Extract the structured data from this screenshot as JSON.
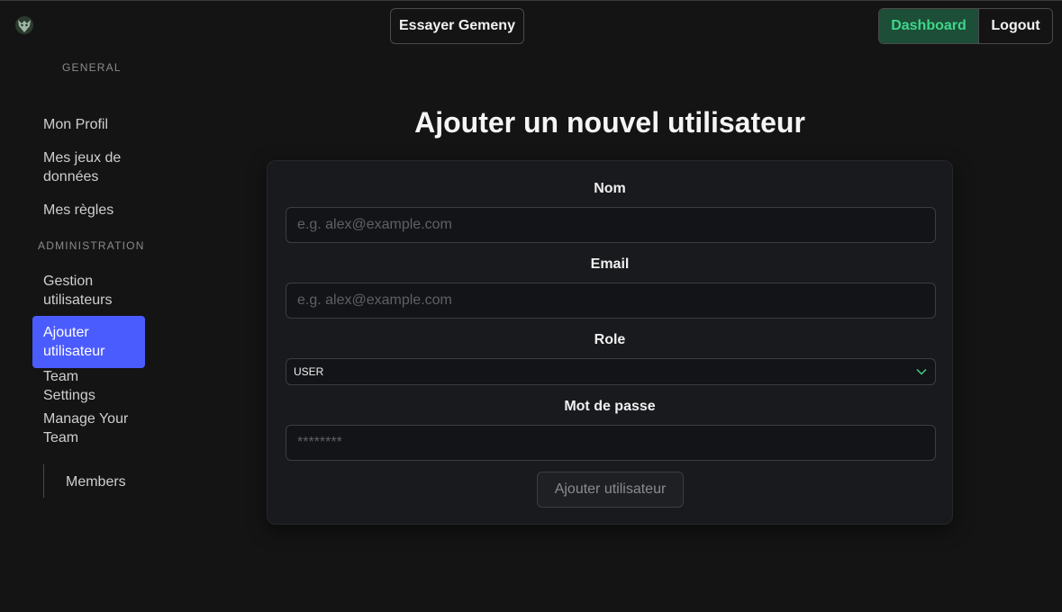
{
  "header": {
    "try_label": "Essayer Gemeny",
    "dashboard_label": "Dashboard",
    "logout_label": "Logout"
  },
  "sidebar": {
    "general_label": "GENERAL",
    "admin_label": "ADMINISTRATION",
    "items": [
      {
        "label": "Mon Profil"
      },
      {
        "label": "Mes jeux de données"
      },
      {
        "label": "Mes règles"
      },
      {
        "label": "Gestion utilisateurs"
      },
      {
        "label": "Ajouter utilisateur"
      },
      {
        "label": "Team Settings"
      },
      {
        "label": "Manage Your Team"
      },
      {
        "label": "Members"
      }
    ]
  },
  "main": {
    "title": "Ajouter un nouvel utilisateur",
    "form": {
      "name_label": "Nom",
      "name_placeholder": "e.g. alex@example.com",
      "email_label": "Email",
      "email_placeholder": "e.g. alex@example.com",
      "role_label": "Role",
      "role_value": "USER",
      "password_label": "Mot de passe",
      "password_placeholder": "********",
      "submit_label": "Ajouter utilisateur"
    }
  },
  "colors": {
    "active_nav": "#4b5cff",
    "dashboard_bg": "#1d4e37",
    "dashboard_text": "#3fd68b",
    "chevron": "#3fd68b"
  },
  "icons": {
    "logo": "wolf-logo-icon",
    "select": "chevron-down-icon"
  }
}
